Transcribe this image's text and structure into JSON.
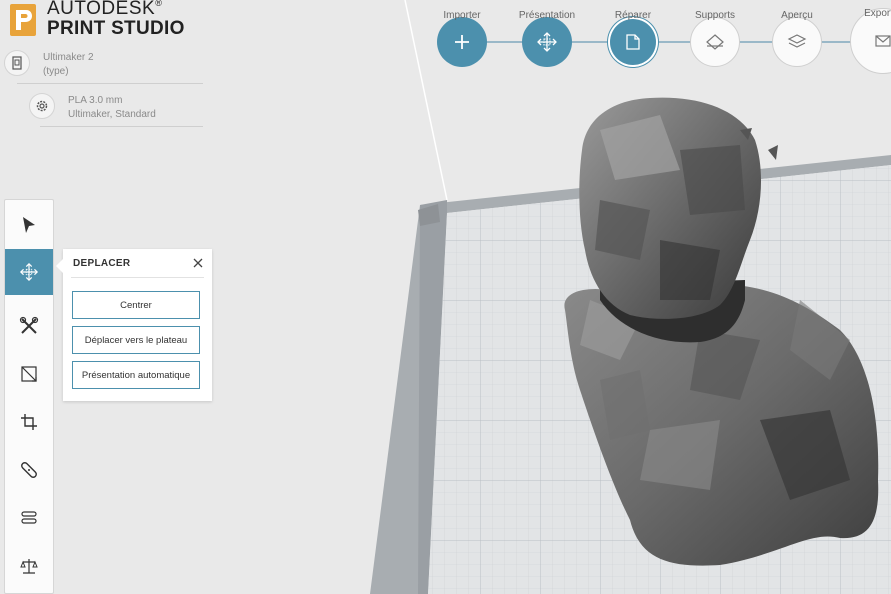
{
  "app": {
    "brand_line1": "AUTODESK",
    "brand_line2": "PRINT STUDIO",
    "logo_letter": "P",
    "accent_color": "#4c90ad",
    "logo_color": "#e8a33a"
  },
  "machine": {
    "name": "Ultimaker 2",
    "subtitle": "(type)"
  },
  "material": {
    "name": "PLA 3.0 mm",
    "subtitle": "Ultimaker, Standard"
  },
  "workflow": {
    "steps": [
      {
        "label": "Importer",
        "icon": "plus-icon",
        "state": "done"
      },
      {
        "label": "Présentation",
        "icon": "move-icon",
        "state": "done"
      },
      {
        "label": "Réparer",
        "icon": "repair-icon",
        "state": "current"
      },
      {
        "label": "Supports",
        "icon": "supports-icon",
        "state": "todo"
      },
      {
        "label": "Aperçu",
        "icon": "layers-icon",
        "state": "todo"
      },
      {
        "label": "Exporter",
        "icon": "export-icon",
        "state": "todo"
      }
    ]
  },
  "toolbar": {
    "tools": [
      {
        "name": "select-tool",
        "icon": "cursor-icon",
        "selected": false
      },
      {
        "name": "move-tool",
        "icon": "move-icon",
        "selected": true
      },
      {
        "name": "repair-tool",
        "icon": "tools-icon",
        "selected": false
      },
      {
        "name": "scale-tool",
        "icon": "scale-icon",
        "selected": false
      },
      {
        "name": "crop-tool",
        "icon": "crop-icon",
        "selected": false
      },
      {
        "name": "supports-tool",
        "icon": "patch-icon",
        "selected": false
      },
      {
        "name": "slice-tool",
        "icon": "layers-icon",
        "selected": false
      },
      {
        "name": "balance-tool",
        "icon": "balance-icon",
        "selected": false
      }
    ]
  },
  "move_panel": {
    "title": "DEPLACER",
    "center_label": "Centrer",
    "to_plate_label": "Déplacer vers le plateau",
    "auto_layout_label": "Présentation automatique"
  }
}
